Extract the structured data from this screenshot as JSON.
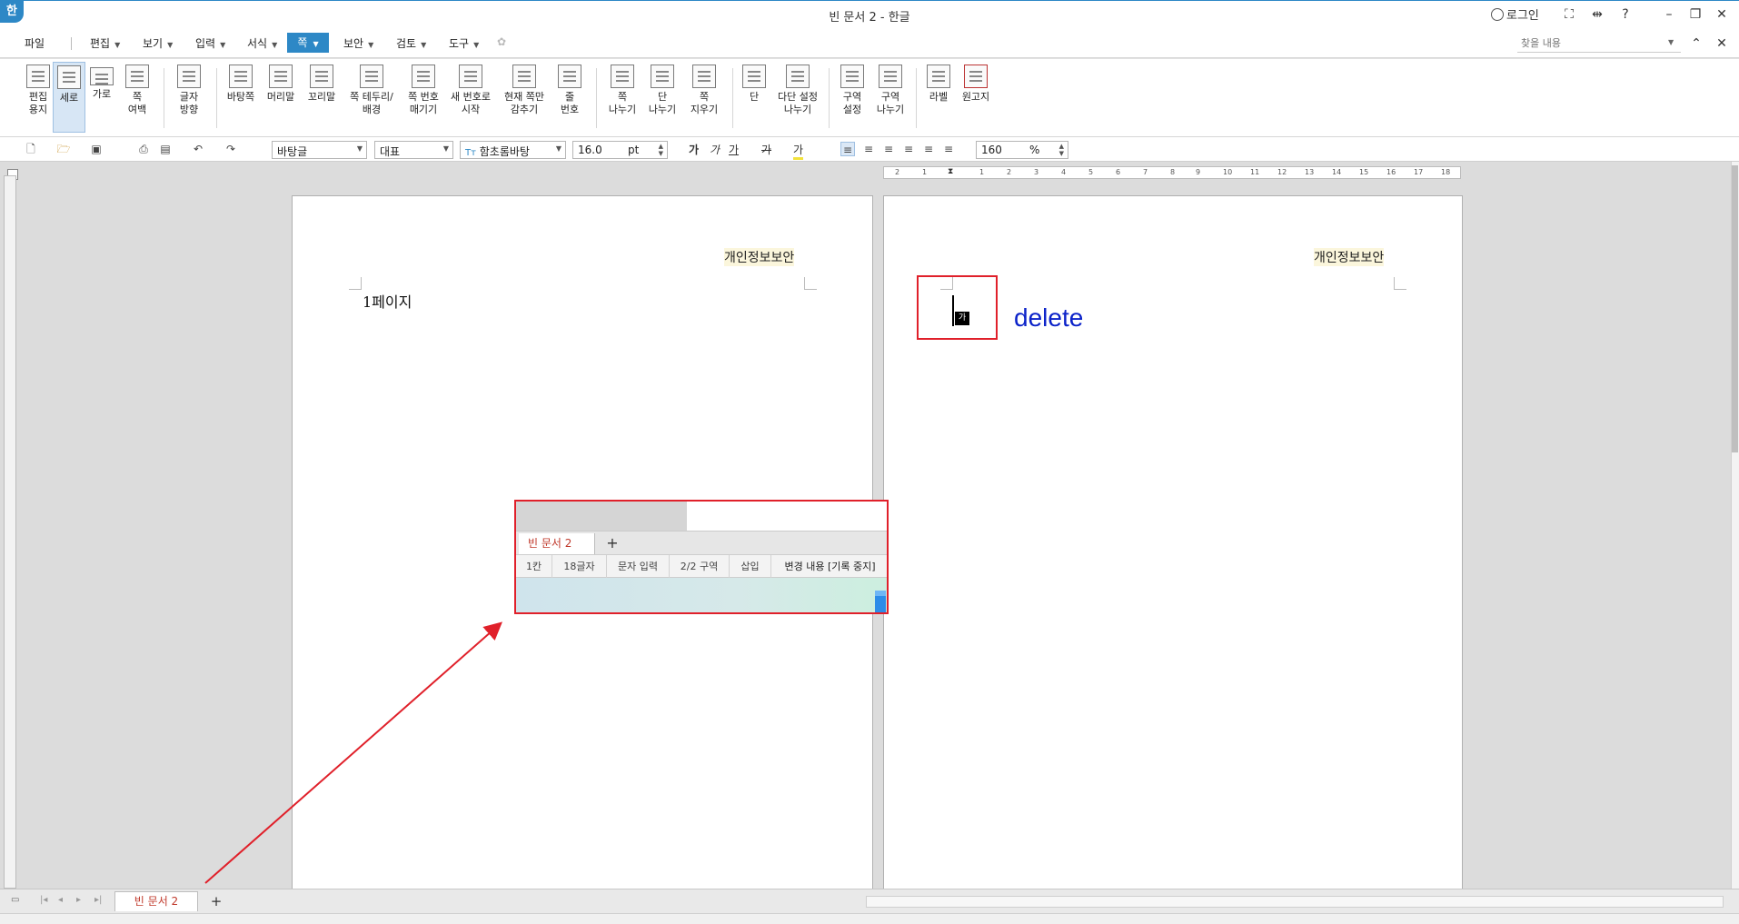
{
  "titlebar": {
    "app_icon": "한",
    "title": "빈 문서 2 - 한글",
    "login": "로그인",
    "help": "?"
  },
  "menubar": {
    "items": [
      "파일",
      "편집",
      "보기",
      "입력",
      "서식",
      "쪽",
      "보안",
      "검토",
      "도구"
    ],
    "active": "쪽",
    "search_placeholder": "찾을 내용"
  },
  "ribbon": {
    "buttons": [
      {
        "label": "편집\n용지",
        "icon": "page-setup-icon"
      },
      {
        "label": "세로",
        "icon": "portrait-icon"
      },
      {
        "label": "가로",
        "icon": "landscape-icon"
      },
      {
        "label": "쪽\n여백",
        "icon": "margin-icon"
      },
      {
        "label": "글자\n방향",
        "icon": "text-direction-icon"
      },
      {
        "label": "바탕쪽",
        "icon": "master-page-icon"
      },
      {
        "label": "머리말",
        "icon": "header-icon"
      },
      {
        "label": "꼬리말",
        "icon": "footer-icon"
      },
      {
        "label": "쪽 테두리/\n배경",
        "icon": "page-border-icon"
      },
      {
        "label": "쪽 번호\n매기기",
        "icon": "page-number-icon"
      },
      {
        "label": "새 번호로\n시작",
        "icon": "new-number-icon"
      },
      {
        "label": "현재 쪽만\n감추기",
        "icon": "hide-page-icon"
      },
      {
        "label": "줄\n번호",
        "icon": "line-number-icon"
      },
      {
        "label": "쪽\n나누기",
        "icon": "page-break-icon"
      },
      {
        "label": "단\n나누기",
        "icon": "column-break-icon"
      },
      {
        "label": "쪽\n지우기",
        "icon": "delete-page-icon"
      },
      {
        "label": "단",
        "icon": "columns-icon"
      },
      {
        "label": "다단 설정\n나누기",
        "icon": "multi-column-icon"
      },
      {
        "label": "구역\n설정",
        "icon": "section-setup-icon"
      },
      {
        "label": "구역\n나누기",
        "icon": "section-break-icon"
      },
      {
        "label": "라벨",
        "icon": "label-icon"
      },
      {
        "label": "원고지",
        "icon": "manuscript-icon"
      }
    ],
    "active": "세로"
  },
  "formatbar": {
    "style": "바탕글",
    "language": "대표",
    "font": "함초롬바탕",
    "font_icon": "Tт",
    "size": "16.0",
    "size_unit": "pt",
    "bold": "가",
    "italic": "가",
    "underline": "가",
    "strike": "가",
    "highlight": "가",
    "zoom": "160",
    "zoom_unit": "%"
  },
  "ruler": {
    "ticks": [
      "2",
      "1",
      "1",
      "2",
      "3",
      "4",
      "5",
      "6",
      "7",
      "8",
      "9",
      "10",
      "11",
      "12",
      "13",
      "14",
      "15",
      "16",
      "17",
      "18"
    ]
  },
  "document": {
    "page1": {
      "header": "개인정보보안",
      "body": "1페이지"
    },
    "page2": {
      "header": "개인정보보안",
      "ime_char": "가"
    },
    "annotation": "delete"
  },
  "tabs": {
    "doc_tab": "빈 문서 2",
    "add": "+"
  },
  "callout": {
    "doc_tab": "빈 문서 2",
    "add": "+",
    "status": [
      "1칸",
      "18글자",
      "문자 입력",
      "2/2 구역",
      "삽입",
      "변경 내용 [기록 중지]"
    ]
  },
  "colors": {
    "accent": "#2d88c6",
    "annotation_red": "#e0202a",
    "delete_blue": "#0b22c9"
  }
}
